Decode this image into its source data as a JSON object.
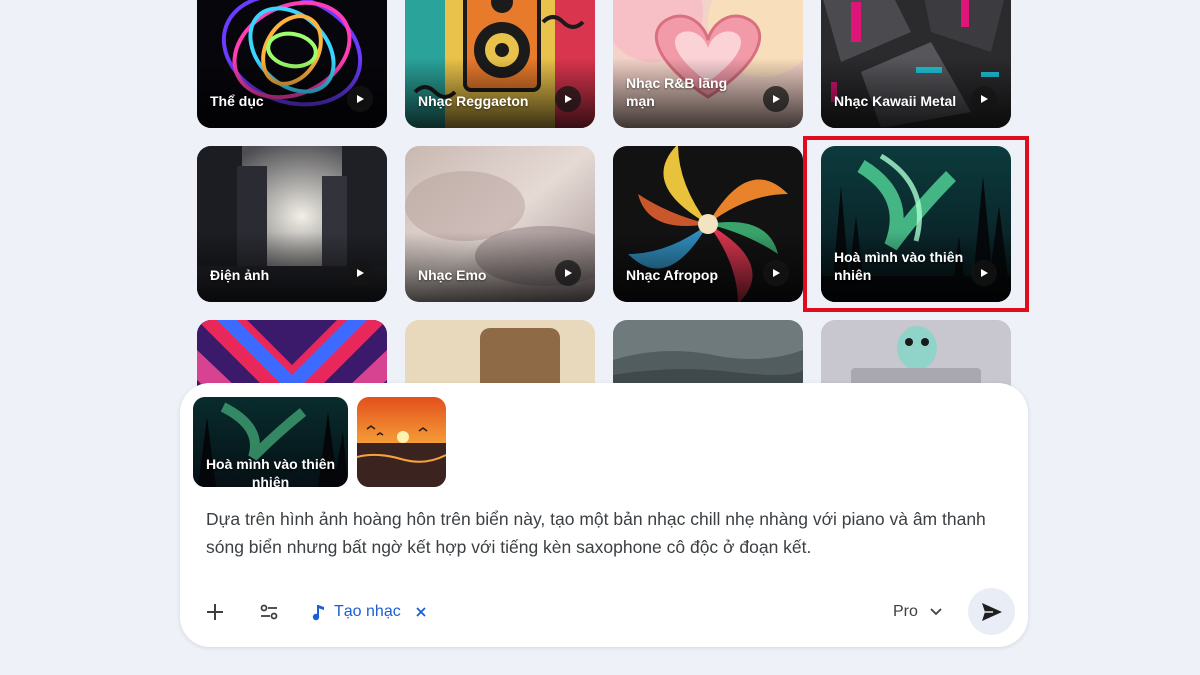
{
  "gallery": [
    {
      "label": "Thể dục",
      "theme": "neon-swirl"
    },
    {
      "label": "Nhạc Reggaeton",
      "theme": "speaker-art"
    },
    {
      "label": "Nhạc R&B lãng mạn",
      "theme": "heart-hands"
    },
    {
      "label": "Nhạc Kawaii Metal",
      "theme": "dark-metal"
    },
    {
      "label": "Điện ảnh",
      "theme": "cinematic-ruins"
    },
    {
      "label": "Nhạc Emo",
      "theme": "misty-haze"
    },
    {
      "label": "Nhạc Afropop",
      "theme": "afro-spiral"
    },
    {
      "label": "Hoà mình vào thiên nhiên",
      "theme": "aurora-forest",
      "highlighted": true
    },
    {
      "label": "",
      "theme": "neon-chevrons"
    },
    {
      "label": "",
      "theme": "sand-rock"
    },
    {
      "label": "",
      "theme": "mountain-mist"
    },
    {
      "label": "",
      "theme": "owl-figure"
    }
  ],
  "composer": {
    "attachments": {
      "style_chip_label": "Hoà mình vào thiên nhiên",
      "image_icon": "sunset-beach-thumbnail"
    },
    "prompt": "Dựa trên hình ảnh hoàng hôn trên biển này, tạo một bản nhạc chill nhẹ nhàng với piano và âm thanh sóng biển nhưng bất ngờ kết hợp với tiếng kèn saxophone cô độc ở đoạn kết.",
    "toolbar": {
      "add_icon": "plus-icon",
      "tools_icon": "sliders-icon",
      "music_tool_label": "Tạo nhạc",
      "music_icon": "music-note-icon",
      "remove_icon": "close-icon",
      "model_label": "Pro",
      "send_icon": "send-icon"
    }
  },
  "colors": {
    "page_background": "#eef2f8",
    "accent": "#1a5fd6",
    "highlight": "#e00b1c",
    "send_bg": "#e9eef6"
  }
}
